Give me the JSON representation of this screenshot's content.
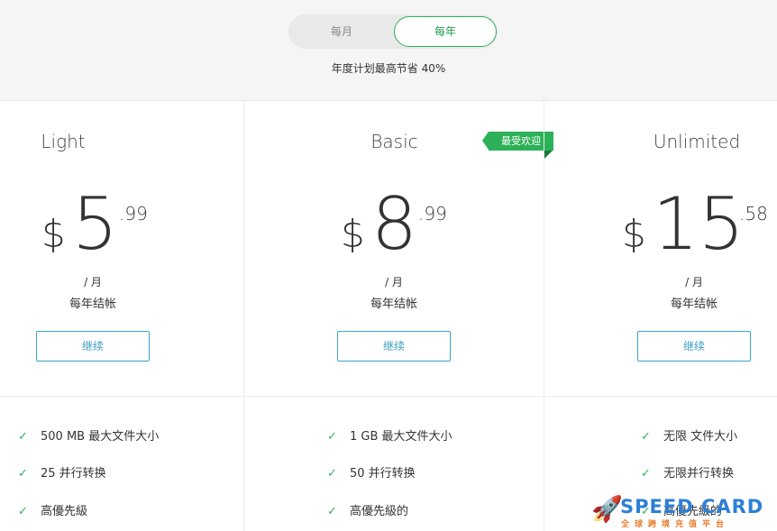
{
  "billing_toggle": {
    "monthly_label": "每月",
    "yearly_label": "每年",
    "selected": "yearly"
  },
  "savings_text": "年度计划最高节省 40%",
  "plans": [
    {
      "name": "Light",
      "currency": "$",
      "whole": "5",
      "cents": ".99",
      "per": "/ 月",
      "billed": "每年结帐",
      "button": "继续",
      "features": [
        "500 MB 最大文件大小",
        "25 并行转换",
        "高優先級"
      ]
    },
    {
      "name": "Basic",
      "badge": "最受欢迎",
      "currency": "$",
      "whole": "8",
      "cents": ".99",
      "per": "/ 月",
      "billed": "每年结帐",
      "button": "继续",
      "features": [
        "1 GB 最大文件大小",
        "50 并行转换",
        "高優先級的"
      ]
    },
    {
      "name": "Unlimited",
      "currency": "$",
      "whole": "15",
      "cents": ".58",
      "per": "/ 月",
      "billed": "每年结帐",
      "button": "继续",
      "features": [
        "无限 文件大小",
        "无限并行转换",
        "高優先級的"
      ]
    }
  ],
  "watermark": {
    "title": "SPEED CARD",
    "subtitle": "全球跨境充值平台"
  },
  "colors": {
    "accent_green": "#2db158",
    "button_blue": "#3aa3c4",
    "watermark_blue": "#2d7fd6",
    "watermark_orange": "#e87b2c"
  }
}
